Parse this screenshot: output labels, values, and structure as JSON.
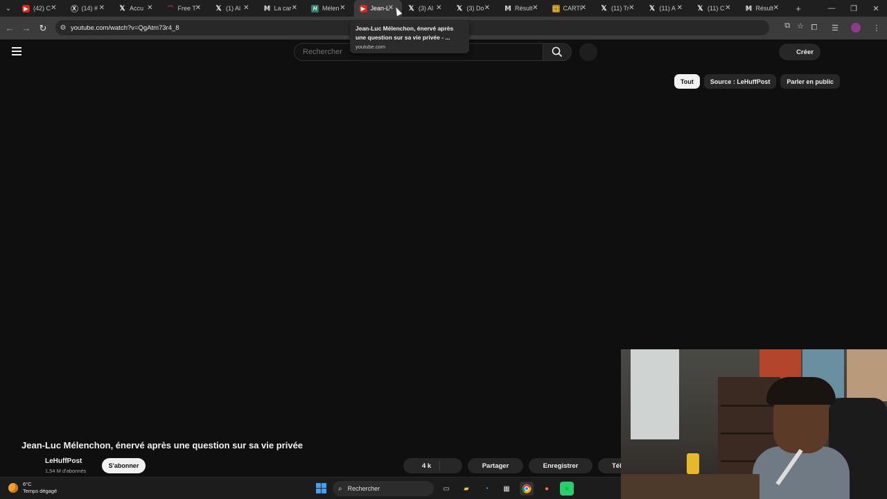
{
  "browser": {
    "tabs": [
      {
        "favicon": "youtube",
        "title": "(42) C"
      },
      {
        "favicon": "x-ring",
        "title": "(14) #"
      },
      {
        "favicon": "x",
        "title": "Accu"
      },
      {
        "favicon": "free",
        "title": "Free T"
      },
      {
        "favicon": "x",
        "title": "(1) Al"
      },
      {
        "favicon": "m",
        "title": "La car"
      },
      {
        "favicon": "h",
        "title": "Mélen"
      },
      {
        "favicon": "youtube",
        "title": "Jean-L",
        "active": true
      },
      {
        "favicon": "x",
        "title": "(3) Al"
      },
      {
        "favicon": "x",
        "title": "(3) Do"
      },
      {
        "favicon": "m",
        "title": "Résult"
      },
      {
        "favicon": "cart",
        "title": "CARTI"
      },
      {
        "favicon": "x",
        "title": "(11) Tr"
      },
      {
        "favicon": "x",
        "title": "(11) A"
      },
      {
        "favicon": "x",
        "title": "(11) C"
      },
      {
        "favicon": "m",
        "title": "Résult"
      }
    ],
    "url": "youtube.com/watch?v=QgAtm73r4_8",
    "tooltip": {
      "title": "Jean-Luc Mélenchon, énervé après une question sur sa vie privée - ...",
      "domain": "youtube.com"
    }
  },
  "youtube": {
    "search_placeholder": "Rechercher",
    "create_label": "Créer",
    "chips": [
      "Tout",
      "Source : LeHuffPost",
      "Parler en public"
    ],
    "video": {
      "title": "Jean-Luc Mélenchon, énervé après une question sur sa vie privée",
      "channel": "LeHuffPost",
      "subscribers": "1,54 M d'abonnés",
      "subscribe_label": "S'abonner",
      "likes": "4 k",
      "share_label": "Partager",
      "save_label": "Enregistrer",
      "download_label": "Téléch"
    }
  },
  "taskbar": {
    "weather_temp": "6°C",
    "weather_condition": "Temps dégagé",
    "search_label": "Rechercher"
  },
  "colors": {
    "page_bg": "#0f0f0f",
    "chip_selected_bg": "#f1f1f1",
    "youtube_red": "#e62117"
  }
}
